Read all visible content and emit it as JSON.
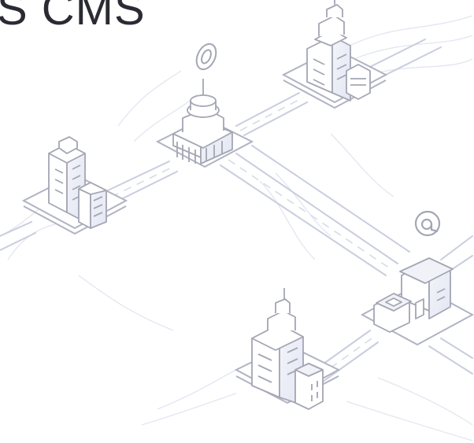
{
  "header": {
    "title_fragment": "S CMS"
  },
  "illustration": {
    "subject": "isometric-city-network",
    "buildings": [
      "tower-top-center",
      "domed-hall-center",
      "office-left",
      "shop-right",
      "skyscraper-bottom"
    ],
    "icons": [
      "location-pin-icon",
      "at-sign-icon"
    ],
    "colors": {
      "stroke": "#a4a6b4",
      "fill": "#ffffff",
      "shade": "#eceef6",
      "road": "#d3d7e8",
      "text": "#2a2b33"
    }
  }
}
